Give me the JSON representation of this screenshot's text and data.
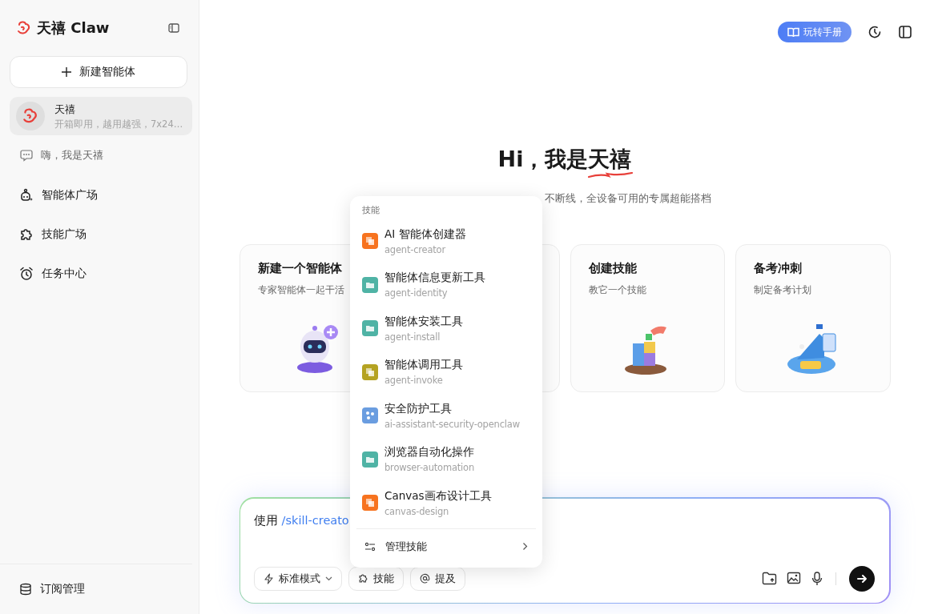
{
  "sidebar": {
    "logo_text": "天禧 Claw",
    "new_agent_button": "新建智能体",
    "agents": [
      {
        "name": "天禧",
        "description": "开箱即用，越用越强，7x24…",
        "selected": true
      }
    ],
    "conversations": [
      {
        "title": "嗨，我是天禧"
      }
    ],
    "nav": [
      {
        "label": "智能体广场",
        "kind": "robot"
      },
      {
        "label": "技能广场",
        "kind": "puzzle"
      },
      {
        "label": "任务中心",
        "kind": "alarm"
      }
    ],
    "footer_item": "订阅管理"
  },
  "header": {
    "guide_button": "玩转手册"
  },
  "hero": {
    "greeting": "Hi，我是",
    "highlight": "天禧",
    "subtitle": "不断线，全设备可用的专属超能搭档"
  },
  "cards": [
    {
      "kind": "robot",
      "title": "新建一个智能体",
      "description": "专家智能体一起干活"
    },
    {
      "kind": "covered"
    },
    {
      "kind": "puzzle",
      "title": "创建技能",
      "description": "教它一个技能"
    },
    {
      "kind": "go",
      "title": "备考冲刺",
      "description": "制定备考计划"
    }
  ],
  "skill_menu": {
    "heading": "技能",
    "items": [
      {
        "name": "AI 智能体创建器",
        "slug": "agent-creator",
        "color": "#f7731f",
        "kind": "squares"
      },
      {
        "name": "智能体信息更新工具",
        "slug": "agent-identity",
        "color": "#4fb3a5",
        "kind": "folder"
      },
      {
        "name": "智能体安装工具",
        "slug": "agent-install",
        "color": "#4fb3a5",
        "kind": "folder"
      },
      {
        "name": "智能体调用工具",
        "slug": "agent-invoke",
        "color": "#b5a322",
        "kind": "squares"
      },
      {
        "name": "安全防护工具",
        "slug": "ai-assistant-security-openclaw",
        "color": "#6a9de0",
        "kind": "dots"
      },
      {
        "name": "浏览器自动化操作",
        "slug": "browser-automation",
        "color": "#4fb3a5",
        "kind": "folder"
      },
      {
        "name": "Canvas画布设计工具",
        "slug": "canvas-design",
        "color": "#f7731f",
        "kind": "squares"
      }
    ],
    "manage": "管理技能"
  },
  "composer": {
    "prefix": "使用",
    "command": "/skill-creato",
    "mode_button": "标准模式",
    "skill_button": "技能",
    "mention_button": "提及"
  }
}
